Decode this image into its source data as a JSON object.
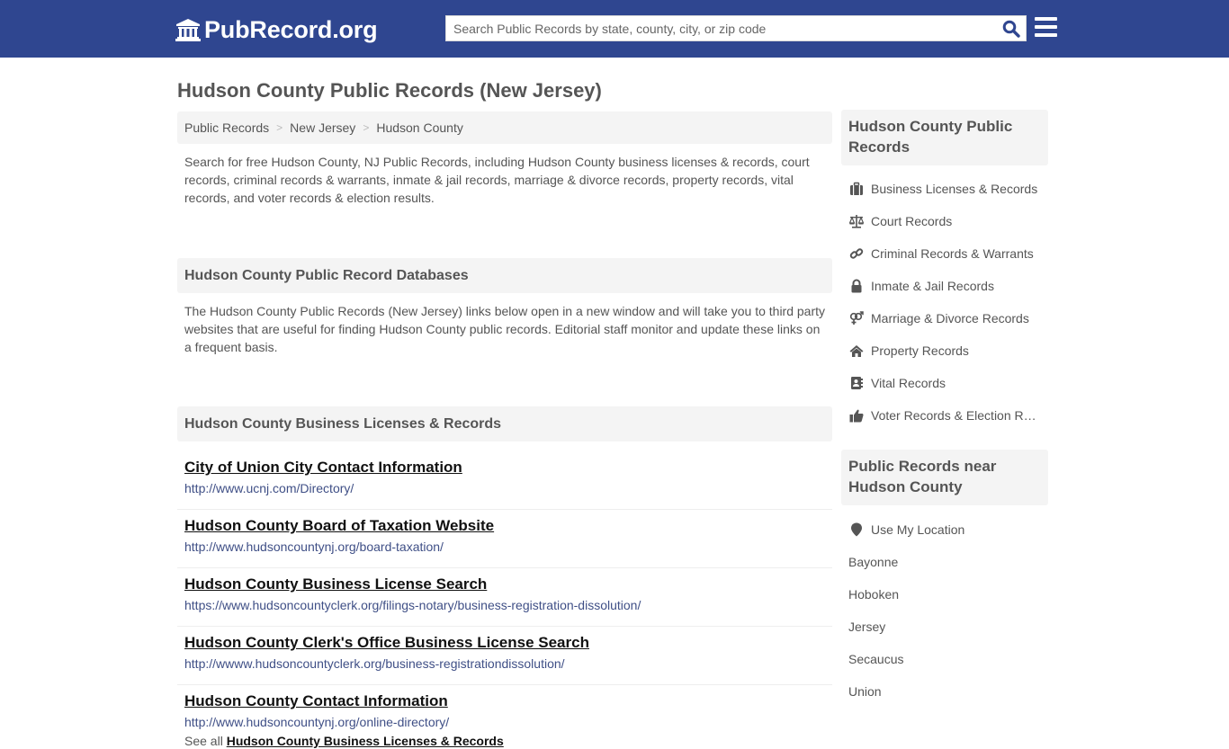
{
  "header": {
    "logo_text": "PubRecord.org",
    "search_placeholder": "Search Public Records by state, county, city, or zip code",
    "search_value": "",
    "colors": {
      "header_bg": "#2f4690",
      "search_icon": "#2f4690"
    }
  },
  "page": {
    "title": "Hudson County Public Records (New Jersey)"
  },
  "breadcrumb": {
    "items": [
      "Public Records",
      "New Jersey",
      "Hudson County"
    ],
    "separator": ">"
  },
  "intro": "Search for free Hudson County, NJ Public Records, including Hudson County business licenses & records, court records, criminal records & warrants, inmate & jail records, marriage & divorce records, property records, vital records, and voter records & election results.",
  "databases": {
    "heading": "Hudson County Public Record Databases",
    "text": "The Hudson County Public Records (New Jersey) links below open in a new window and will take you to third party websites that are useful for finding Hudson County public records. Editorial staff monitor and update these links on a frequent basis."
  },
  "business": {
    "heading": "Hudson County Business Licenses & Records",
    "links": [
      {
        "title": "City of Union City Contact Information",
        "url": "http://www.ucnj.com/Directory/"
      },
      {
        "title": "Hudson County Board of Taxation Website",
        "url": "http://www.hudsoncountynj.org/board-taxation/"
      },
      {
        "title": "Hudson County Business License Search",
        "url": "https://www.hudsoncountyclerk.org/filings-notary/business-registration-dissolution/"
      },
      {
        "title": "Hudson County Clerk's Office Business License Search",
        "url": "http://wwww.hudsoncountyclerk.org/business-registrationdissolution/"
      },
      {
        "title": "Hudson County Contact Information",
        "url": "http://www.hudsoncountynj.org/online-directory/"
      }
    ],
    "see_all_prefix": "See all",
    "see_all_link": "Hudson County Business Licenses & Records"
  },
  "sidebar": {
    "records_heading": "Hudson County Public Records",
    "records": [
      {
        "icon": "briefcase-icon",
        "label": "Business Licenses & Records"
      },
      {
        "icon": "balance-scale-icon",
        "label": "Court Records"
      },
      {
        "icon": "link-icon",
        "label": "Criminal Records & Warrants"
      },
      {
        "icon": "lock-icon",
        "label": "Inmate & Jail Records"
      },
      {
        "icon": "venus-mars-icon",
        "label": "Marriage & Divorce Records"
      },
      {
        "icon": "home-icon",
        "label": "Property Records"
      },
      {
        "icon": "address-book-icon",
        "label": "Vital Records"
      },
      {
        "icon": "thumbs-up-icon",
        "label": "Voter Records & Election Results"
      }
    ],
    "near_heading": "Public Records near Hudson County",
    "use_location": "Use My Location",
    "near": [
      "Bayonne",
      "Hoboken",
      "Jersey",
      "Secaucus",
      "Union"
    ]
  }
}
